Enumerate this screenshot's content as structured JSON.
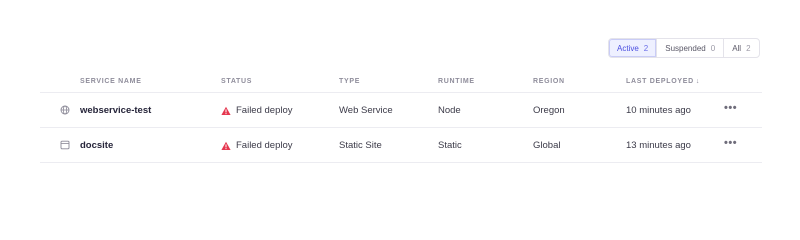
{
  "filters": [
    {
      "label": "Active",
      "count": "2",
      "active": true
    },
    {
      "label": "Suspended",
      "count": "0",
      "active": false
    },
    {
      "label": "All",
      "count": "2",
      "active": false
    }
  ],
  "columns": {
    "service_name": "Service Name",
    "status": "Status",
    "type": "Type",
    "runtime": "Runtime",
    "region": "Region",
    "last_deployed": "Last Deployed"
  },
  "rows": [
    {
      "icon": "globe-icon",
      "name": "webservice-test",
      "status": "Failed deploy",
      "type": "Web Service",
      "runtime": "Node",
      "region": "Oregon",
      "last_deployed": "10 minutes ago",
      "menu": "•••"
    },
    {
      "icon": "static-site-icon",
      "name": "docsite",
      "status": "Failed deploy",
      "type": "Static Site",
      "runtime": "Static",
      "region": "Global",
      "last_deployed": "13 minutes ago",
      "menu": "•••"
    }
  ],
  "colors": {
    "accent": "#4b4ee0",
    "failed": "#e5374f",
    "muted": "#8f8d9b"
  },
  "sort_indicator": "↓"
}
